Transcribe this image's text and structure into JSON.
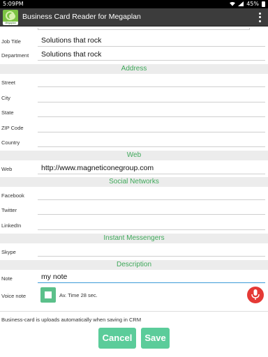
{
  "status_bar": {
    "time": "5:09PM",
    "battery": "45%"
  },
  "app": {
    "title": "Business Card Reader for Megaplan",
    "icon_text": "Megaplan"
  },
  "fields": {
    "job_title": {
      "label": "Job Title",
      "value": "Solutions that rock"
    },
    "department": {
      "label": "Department",
      "value": "Solutions that rock"
    },
    "street": {
      "label": "Street",
      "value": ""
    },
    "city": {
      "label": "City",
      "value": ""
    },
    "state": {
      "label": "State",
      "value": ""
    },
    "zip": {
      "label": "ZIP Code",
      "value": ""
    },
    "country": {
      "label": "Country",
      "value": ""
    },
    "web": {
      "label": "Web",
      "value": "http://www.magneticonegroup.com"
    },
    "facebook": {
      "label": "Facebook",
      "value": ""
    },
    "twitter": {
      "label": "Twitter",
      "value": ""
    },
    "linkedin": {
      "label": "LinkedIn",
      "value": ""
    },
    "skype": {
      "label": "Skype",
      "value": ""
    },
    "note": {
      "label": "Note",
      "value": "my note"
    }
  },
  "sections": {
    "address": "Address",
    "web": "Web",
    "social": "Social Networks",
    "messengers": "Instant Messengers",
    "description": "Description"
  },
  "voice_note": {
    "label": "Voice note",
    "time_text": "Av. Time 28 sec."
  },
  "info_text": "Business-card is uploads automatically when saving in CRM",
  "buttons": {
    "cancel": "Cancel",
    "save": "Save"
  },
  "colors": {
    "accent_green": "#5bcc9a",
    "section_text": "#3fa85a",
    "mic_red": "#e53935",
    "focus_blue": "#3d9bd8"
  }
}
